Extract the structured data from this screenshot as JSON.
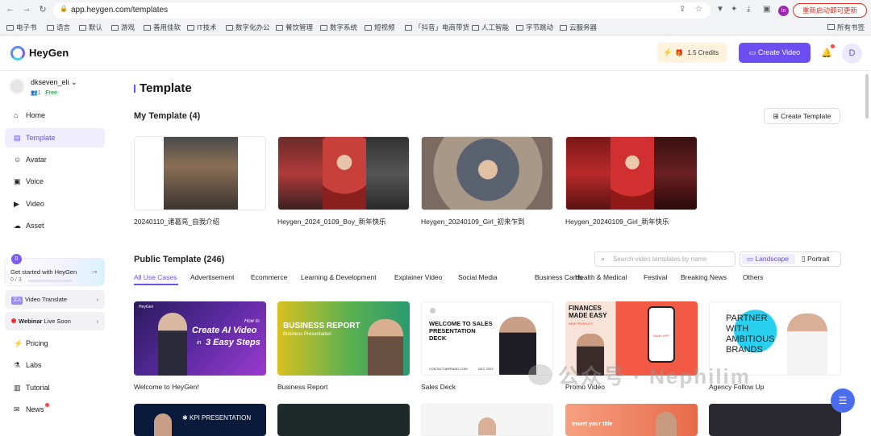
{
  "browser": {
    "url": "app.heygen.com/templates",
    "profile_initial": "In",
    "restart_label": "重新启动即可更新",
    "bookmarks": [
      "电子书",
      "语言",
      "默认",
      "游戏",
      "善用佳软",
      "IT技术",
      "数字化办公",
      "餐饮管理",
      "数字系统",
      "短视频",
      "「抖音」电商带货",
      "人工智能",
      "字节跳动",
      "云服务器"
    ],
    "all_bookmarks": "所有书签"
  },
  "app": {
    "logo": "HeyGen",
    "credits": "1.5 Credits",
    "create_video": "Create Video",
    "user_initial": "D"
  },
  "workspace": {
    "name": "dkseven_eli",
    "members": "1",
    "plan": "Free"
  },
  "nav": [
    {
      "label": "Home",
      "icon": "home-icon"
    },
    {
      "label": "Template",
      "icon": "template-icon"
    },
    {
      "label": "Avatar",
      "icon": "avatar-icon"
    },
    {
      "label": "Voice",
      "icon": "voice-icon"
    },
    {
      "label": "Video",
      "icon": "video-icon"
    },
    {
      "label": "Asset",
      "icon": "asset-icon"
    }
  ],
  "get_started": {
    "badge": "0",
    "title": "Get started with HeyGen",
    "progress": "0 / 3"
  },
  "video_translate": {
    "icon": "文A",
    "label": "Video Translate"
  },
  "webinar": {
    "bold": "Webinar",
    "rest": "Live Soon"
  },
  "nav2": [
    {
      "label": "Pricing"
    },
    {
      "label": "Labs"
    },
    {
      "label": "Tutorial"
    },
    {
      "label": "News"
    }
  ],
  "page": {
    "title": "Template",
    "my_template_heading": "My Template (4)",
    "create_template": "Create Template",
    "my_templates": [
      "20240110_诸葛亮_自我介绍",
      "Heygen_2024_0109_Boy_新年快乐",
      "Heygen_20240109_Girl_初来乍到",
      "Heygen_20240109_Girl_新年快乐"
    ],
    "public_heading": "Public Template (246)",
    "search_placeholder": "Search video templates by name",
    "landscape": "Landscape",
    "portrait": "Portrait",
    "categories": [
      "All Use Cases",
      "Advertisement",
      "Ecommerce",
      "Learning & Development",
      "Explainer Video",
      "Social Media",
      "Business Cards",
      "Health & Medical",
      "Festival",
      "Breaking News",
      "Others"
    ],
    "public_templates": [
      "Welcome to HeyGen!",
      "Business Report",
      "Sales Deck",
      "Promo Video",
      "Agency Follow Up"
    ],
    "card_text": {
      "c1_brand": "HeyGen",
      "c1_small": "How to",
      "c1_title": "Create AI Video",
      "c1_in": "in",
      "c1_sub": "3 Easy Steps",
      "c2_title": "BUSINESS REPORT",
      "c2_sub": "Business Presentation",
      "c3_title": "WELCOME TO SALES PRESENTATION DECK",
      "c3_mail": "CONTACT@BRAND.COM",
      "c3_date": "DEC 2023",
      "c4_title": "FINANCES MADE EASY",
      "c4_sub": "NEW PRODUCT",
      "c4_app": "BANK APP",
      "c5_title": "PARTNER WITH AMBITIOUS BRANDS",
      "r3_kpi": "KPI PRESENTATION",
      "r3_insert": "Insert your title"
    }
  },
  "watermark": "公众号 · Nephilim"
}
